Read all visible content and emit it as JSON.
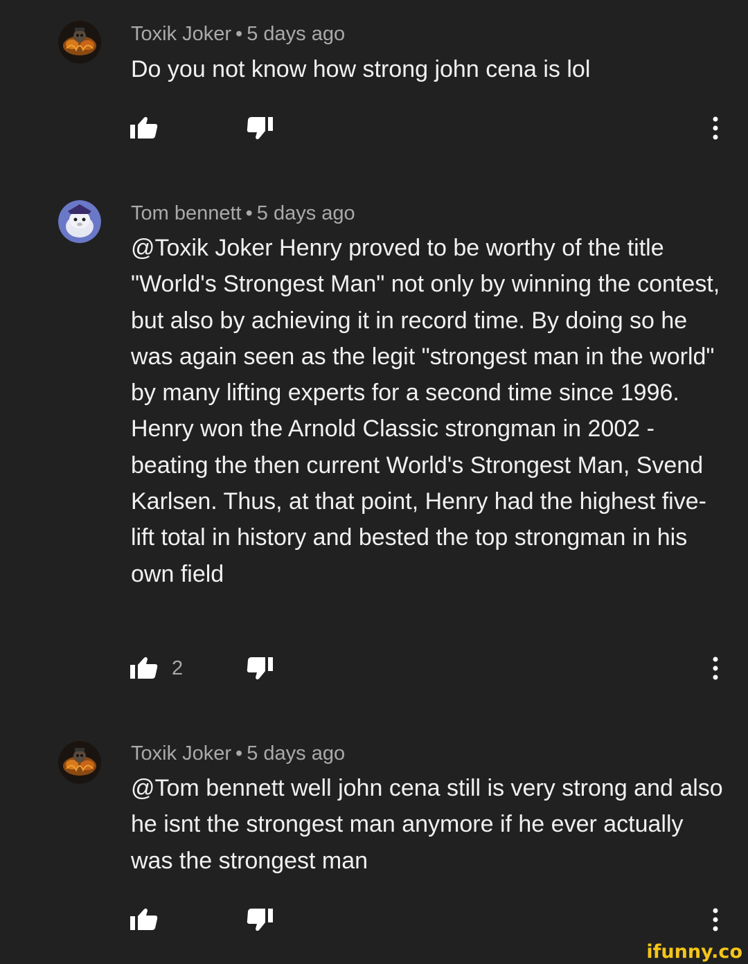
{
  "comments": [
    {
      "author": "Toxik Joker",
      "separator": "•",
      "time": "5 days ago",
      "text": "Do you not know how strong john cena is lol",
      "likes": "",
      "avatar": "fire-skull-avatar"
    },
    {
      "author": "Tom bennett",
      "separator": "•",
      "time": "5 days ago",
      "text": "@Toxik Joker Henry proved to be worthy of the title \"World's Strongest Man\" not only by winning the contest, but also by achieving it in record time. By doing so he was again seen as the legit \"strongest man in the world\" by many lifting experts for a second time since 1996. Henry won the Arnold Classic strongman in 2002 - beating the then current World's Strongest Man, Svend Karlsen. Thus, at that point, Henry had the highest five-lift total in history and bested the top strongman in his own field",
      "likes": "2",
      "avatar": "white-creature-avatar"
    },
    {
      "author": "Toxik Joker",
      "separator": "•",
      "time": "5 days ago",
      "text": "@Tom bennett well john cena still is very strong and also he isnt the strongest man anymore if he ever actually was the strongest man",
      "likes": "",
      "avatar": "fire-skull-avatar"
    }
  ],
  "watermark": "ifunny.co",
  "icons": {
    "like": "thumbs-up-icon",
    "dislike": "thumbs-down-icon",
    "more": "more-vertical-icon"
  },
  "colors": {
    "background": "#212121",
    "primary_text": "#f1f1f1",
    "secondary_text": "#aaaaaa",
    "watermark": "#f5c518"
  }
}
